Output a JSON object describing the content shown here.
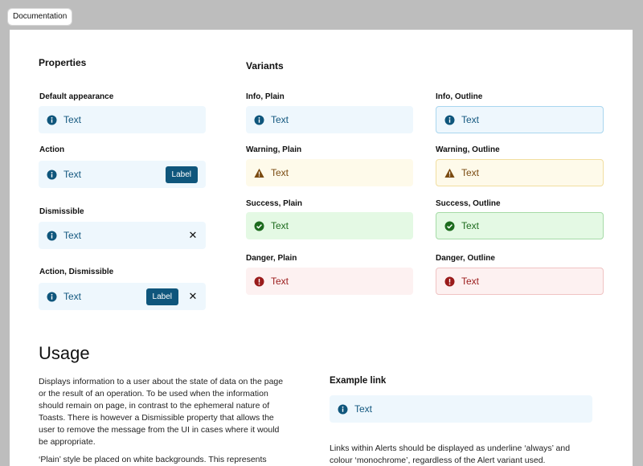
{
  "tab": {
    "label": "Documentation"
  },
  "properties": {
    "heading": "Properties",
    "items": [
      {
        "label": "Default appearance",
        "text": "Text"
      },
      {
        "label": "Action",
        "text": "Text",
        "button": "Label"
      },
      {
        "label": "Dismissible",
        "text": "Text",
        "close": "✕"
      },
      {
        "label": "Action, Dismissible",
        "text": "Text",
        "button": "Label",
        "close": "✕"
      }
    ]
  },
  "variants": {
    "heading": "Variants",
    "items": [
      {
        "label": "Info, Plain",
        "text": "Text"
      },
      {
        "label": "Info, Outline",
        "text": "Text"
      },
      {
        "label": "Warning, Plain",
        "text": "Text"
      },
      {
        "label": "Warning, Outline",
        "text": "Text"
      },
      {
        "label": "Success, Plain",
        "text": "Text"
      },
      {
        "label": "Success, Outline",
        "text": "Text"
      },
      {
        "label": "Danger, Plain",
        "text": "Text"
      },
      {
        "label": "Danger, Outline",
        "text": "Text"
      }
    ]
  },
  "usage": {
    "title": "Usage",
    "paragraph1": "Displays information to a user about the state of data on the page or the result of an operation. To be used when the information should remain on page, in contrast to the ephemeral nature of Toasts. There is however a Dismissible property that allows the user to remove the message from the UI in cases where it would be appropriate.",
    "paragraph2": "‘Plain’ style be placed on white backgrounds. This represents"
  },
  "example": {
    "heading": "Example link",
    "alert_text": "Text",
    "note": "Links within Alerts should be displayed as underline ‘always’ and colour ‘monochrome’, regardless of the Alert variant used."
  },
  "colors": {
    "info_fg": "#12577f",
    "warning_fg": "#7a4a10",
    "success_fg": "#1d6b1e",
    "danger_fg": "#9a1b1b",
    "button_bg": "#0f567c"
  }
}
